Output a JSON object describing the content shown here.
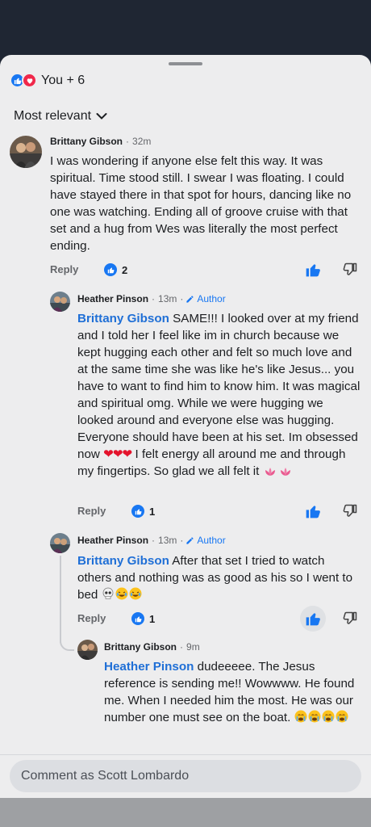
{
  "reactions": {
    "count_label": "You + 6"
  },
  "sort": {
    "label": "Most relevant"
  },
  "comments": [
    {
      "author": "Brittany Gibson",
      "time": "32m",
      "body": "I was wondering if anyone else felt this way. It was spiritual. Time stood still. I swear I was floating. I could have stayed there in that spot for hours, dancing like no one was watching. Ending all of groove cruise with that set and a hug from Wes was literally the most perfect ending.",
      "reply_label": "Reply",
      "like_count": "2"
    },
    {
      "author": "Heather Pinson",
      "time": "13m",
      "author_badge": "Author",
      "mention": "Brittany Gibson",
      "body": " SAME!!! I looked over at my friend and I told her I feel like im in church because we kept hugging each other and felt so much love and at the same time she was like he's like Jesus... you have to want to find him to know him. It was magical and spiritual omg. While we were hugging we looked around and everyone else was hugging. Everyone should have been at his set. Im obsessed now ",
      "hearts": "❤❤❤",
      "body_end": " I felt energy all around me and through my fingertips. So glad we all felt it ",
      "reply_label": "Reply",
      "like_count": "1"
    },
    {
      "author": "Heather Pinson",
      "time": "13m",
      "author_badge": "Author",
      "mention": "Brittany Gibson",
      "body": " After that set I tried to watch others and nothing was as good as his so I went to bed ",
      "reply_label": "Reply",
      "like_count": "1"
    },
    {
      "author": "Brittany Gibson",
      "time": "9m",
      "mention": "Heather Pinson",
      "body": " dudeeeee. The Jesus reference is sending me!! Wowwww. He found me. When I needed him the most. He was our number one must see on the boat. "
    }
  ],
  "composer": {
    "placeholder": "Comment as Scott Lombardo"
  },
  "colors": {
    "accent": "#1877f2",
    "love": "#f0284a",
    "sheet": "#ededee",
    "header_bg": "#1f2633"
  },
  "icons": [
    "like-icon",
    "love-icon",
    "chevron-down-icon",
    "thumbs-up-icon",
    "thumbs-down-icon",
    "pencil-icon",
    "skull-emoji",
    "laughing-emoji",
    "crying-emoji",
    "lotus-emoji"
  ]
}
